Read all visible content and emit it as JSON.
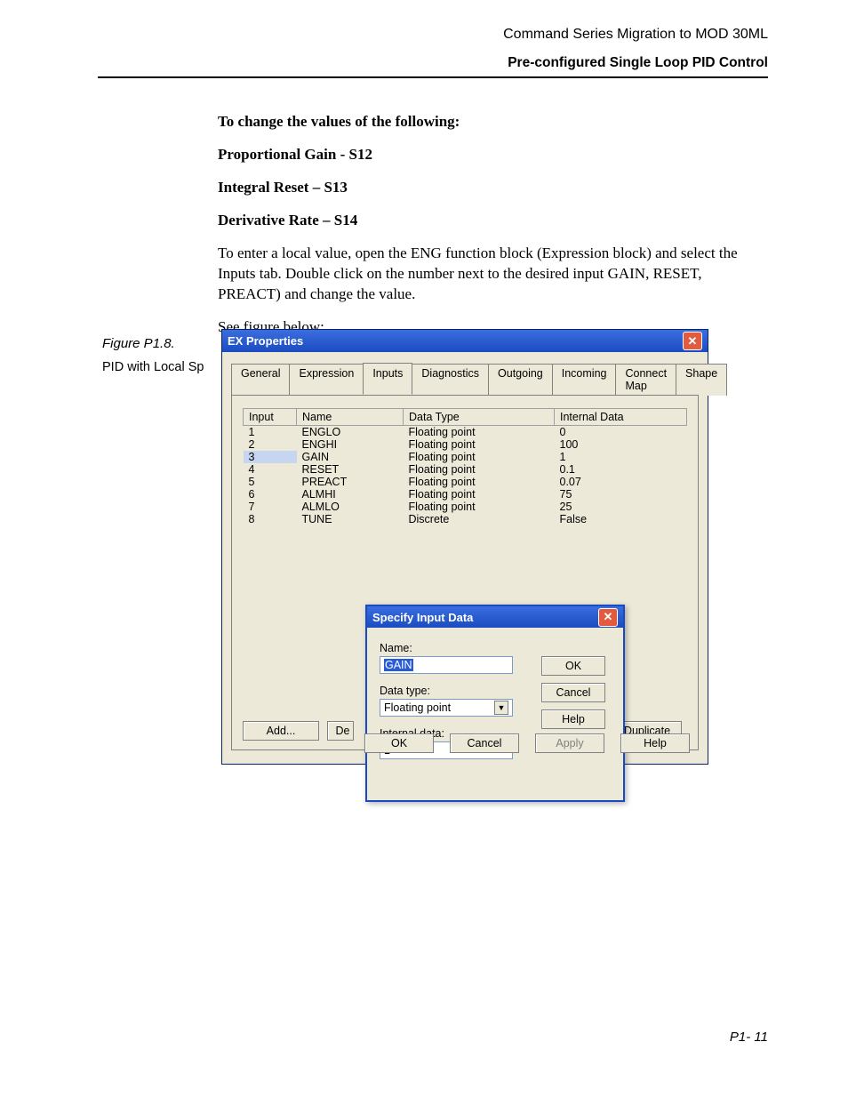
{
  "header": {
    "line1": "Command Series Migration to MOD 30ML",
    "line2": "Pre-configured Single Loop PID Control"
  },
  "body": {
    "heading": "To change the values of the following:",
    "items": [
      "Proportional Gain - S12",
      "Integral Reset – S13",
      "Derivative Rate – S14"
    ],
    "para": "To enter a local value, open the ENG function block (Expression block) and select the Inputs tab. Double click on the number next to the desired input GAIN, RESET, PREACT) and change the value.",
    "see": "See figure below:"
  },
  "figure": {
    "num": "Figure P1.8.",
    "caption": "PID with Local Sp"
  },
  "exwin": {
    "title": "EX Properties",
    "tabs": [
      "General",
      "Expression",
      "Inputs",
      "Diagnostics",
      "Outgoing",
      "Incoming",
      "Connect Map",
      "Shape"
    ],
    "active_tab": "Inputs",
    "columns": [
      "Input",
      "Name",
      "Data Type",
      "Internal Data"
    ],
    "rows": [
      {
        "n": "1",
        "name": "ENGLO",
        "type": "Floating point",
        "data": "0"
      },
      {
        "n": "2",
        "name": "ENGHI",
        "type": "Floating point",
        "data": "100"
      },
      {
        "n": "3",
        "name": "GAIN",
        "type": "Floating point",
        "data": "1",
        "selected": true
      },
      {
        "n": "4",
        "name": "RESET",
        "type": "Floating point",
        "data": "0.1"
      },
      {
        "n": "5",
        "name": "PREACT",
        "type": "Floating point",
        "data": "0.07"
      },
      {
        "n": "6",
        "name": "ALMHI",
        "type": "Floating point",
        "data": "75"
      },
      {
        "n": "7",
        "name": "ALMLO",
        "type": "Floating point",
        "data": "25"
      },
      {
        "n": "8",
        "name": "TUNE",
        "type": "Discrete",
        "data": "False"
      }
    ],
    "buttons": {
      "add": "Add...",
      "delete_partial": "De",
      "duplicate": "Duplicate",
      "ok": "OK",
      "cancel": "Cancel",
      "apply": "Apply",
      "help": "Help"
    }
  },
  "dlg": {
    "title": "Specify Input Data",
    "labels": {
      "name": "Name:",
      "datatype": "Data type:",
      "internal": "Internal data:"
    },
    "values": {
      "name": "GAIN",
      "datatype": "Floating point",
      "internal": "1"
    },
    "buttons": {
      "ok": "OK",
      "cancel": "Cancel",
      "help": "Help"
    }
  },
  "footer": "P1- 11"
}
